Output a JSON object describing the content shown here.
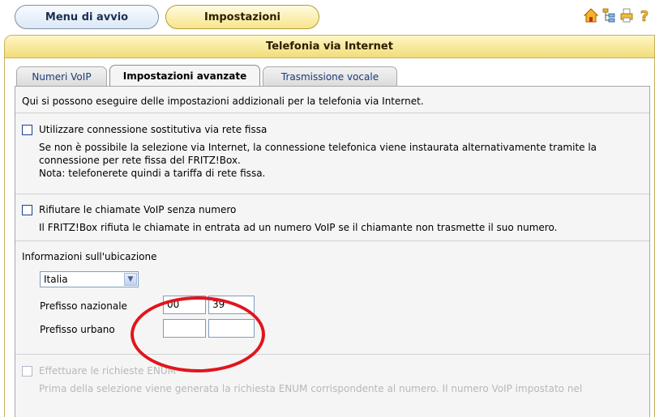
{
  "nav": {
    "menu_label": "Menu di avvio",
    "settings_label": "Impostazioni"
  },
  "toolbar_icons": [
    "home-icon",
    "sitemap-icon",
    "print-icon",
    "help-icon"
  ],
  "panel": {
    "title": "Telefonia via Internet"
  },
  "tabs": [
    {
      "label": "Numeri VoIP",
      "active": false
    },
    {
      "label": "Impostazioni avanzate",
      "active": true
    },
    {
      "label": "Trasmissione vocale",
      "active": false
    }
  ],
  "intro": "Qui si possono eseguire delle impostazioni addizionali per la telefonia via Internet.",
  "fallback": {
    "label": "Utilizzare connessione sostitutiva via rete fissa",
    "checked": false,
    "desc_line1": "Se non è possibile la selezione via Internet, la connessione telefonica viene instaurata alternativamente tramite la",
    "desc_line2": "connessione per rete fissa del FRITZ!Box.",
    "desc_line3": "Nota: telefonerete quindi a tariffa di rete fissa."
  },
  "reject": {
    "label": "Rifiutare le chiamate VoIP senza numero",
    "checked": false,
    "desc": "Il FRITZ!Box rifiuta le chiamate in entrata ad un numero VoIP se il chiamante non trasmette il suo numero."
  },
  "location": {
    "heading": "Informazioni sull'ubicazione",
    "country": "Italia",
    "national_prefix_label": "Prefisso nazionale",
    "national_prefix_1": "00",
    "national_prefix_2": "39",
    "area_code_label": "Prefisso urbano",
    "area_code_1": "",
    "area_code_2": ""
  },
  "enum": {
    "label": "Effettuare le richieste ENUM",
    "checked": false,
    "desc": "Prima della selezione viene generata la richiesta ENUM corrispondente al numero. Il numero VoIP impostato nel"
  },
  "colors": {
    "header_bg": "#f1dd7a",
    "annotation": "#e0161d",
    "content_bg": "#f5f5f5"
  }
}
